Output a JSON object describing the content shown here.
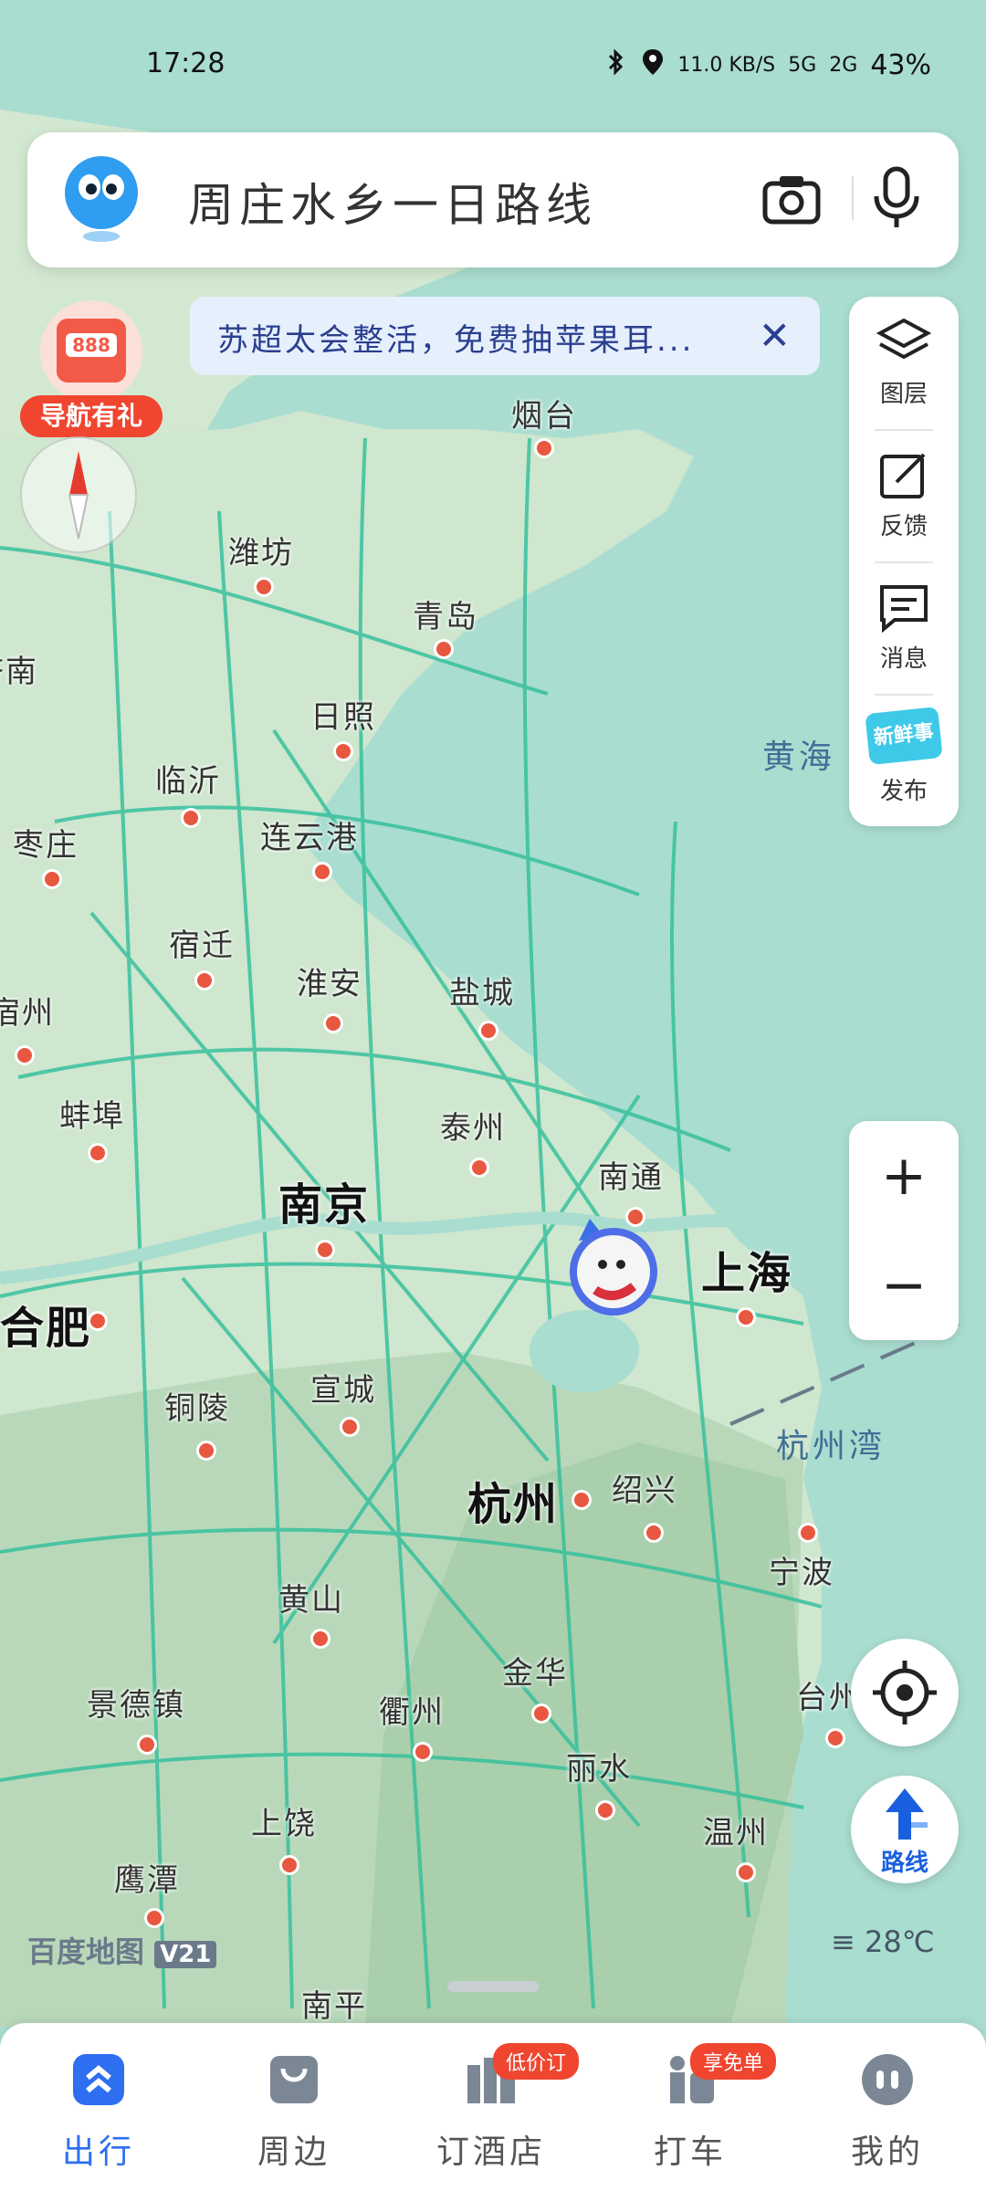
{
  "status_bar": {
    "time": "17:28",
    "net_speed": "11.0 KB/S",
    "signal_1": "5G",
    "signal_2": "2G",
    "battery": "43%"
  },
  "search": {
    "placeholder": "周庄水乡一日路线"
  },
  "promo": {
    "label": "导航有礼"
  },
  "notice": {
    "text": "苏超太会整活，免费抽苹果耳...",
    "close": "✕"
  },
  "side_panel": [
    {
      "label": "图层",
      "icon": "layers-icon"
    },
    {
      "label": "反馈",
      "icon": "feedback-icon"
    },
    {
      "label": "消息",
      "icon": "message-icon"
    },
    {
      "label": "发布",
      "icon": "new-post-icon",
      "badge": "新鲜事"
    }
  ],
  "zoom": {
    "in": "+",
    "out": "−"
  },
  "route_button": {
    "label": "路线"
  },
  "brand": {
    "name": "百度地图",
    "version": "V21"
  },
  "weather": {
    "temp": "28℃"
  },
  "map": {
    "cities": [
      "烟台",
      "潍坊",
      "青岛",
      "日照",
      "临沂",
      "枣庄",
      "连云港",
      "宿迁",
      "淮安",
      "盐城",
      "蚌埠",
      "泰州",
      "南京",
      "南通",
      "上海",
      "合肥",
      "铜陵",
      "宣城",
      "杭州",
      "绍兴",
      "宁波",
      "黄山",
      "金华",
      "景德镇",
      "衢州",
      "丽水",
      "温州",
      "上饶",
      "鹰潭",
      "南平",
      "台州",
      "宿州",
      "济南"
    ],
    "seas": [
      "黄海",
      "杭州湾"
    ]
  },
  "tabs": [
    {
      "label": "出行",
      "icon": "travel-icon",
      "active": true
    },
    {
      "label": "周边",
      "icon": "nearby-icon"
    },
    {
      "label": "订酒店",
      "icon": "hotel-icon",
      "badge": "低价订"
    },
    {
      "label": "打车",
      "icon": "taxi-icon",
      "badge": "享免单"
    },
    {
      "label": "我的",
      "icon": "profile-icon"
    }
  ],
  "colors": {
    "accent": "#2e6ef0",
    "badge": "#f0452f",
    "sea": "#a9ddd0",
    "land": "#d9ecd6"
  }
}
